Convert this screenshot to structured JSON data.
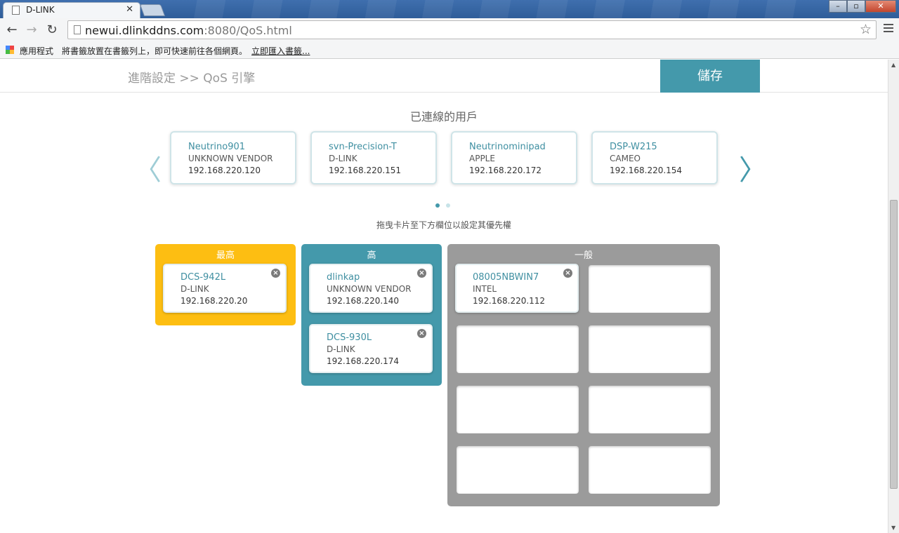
{
  "browser": {
    "tab_title": "D-LINK",
    "tab_close": "✕",
    "back": "←",
    "forward": "→",
    "reload": "↻",
    "url_host": "newui.dlinkddns.com",
    "url_rest": ":8080/QoS.html",
    "bookmarks": {
      "apps": "應用程式",
      "tip": "將書籤放置在書籤列上，即可快速前往各個網頁。",
      "import": "立即匯入書籤..."
    }
  },
  "header": {
    "breadcrumb": "進階設定 >> QoS 引擎",
    "save_label": "儲存"
  },
  "connected": {
    "title": "已連線的用戶",
    "prev": "〈",
    "next": "〉",
    "clients": [
      {
        "name": "Neutrino901",
        "vendor": "UNKNOWN VENDOR",
        "ip": "192.168.220.120"
      },
      {
        "name": "svn-Precision-T",
        "vendor": "D-LINK",
        "ip": "192.168.220.151"
      },
      {
        "name": "Neutrinominipad",
        "vendor": "APPLE",
        "ip": "192.168.220.172"
      },
      {
        "name": "DSP-W215",
        "vendor": "CAMEO",
        "ip": "192.168.220.154"
      }
    ],
    "page_count": 2,
    "current_page": 1
  },
  "instruction": "拖曳卡片至下方欄位以設定其優先權",
  "priorities": {
    "highest": {
      "title": "最高",
      "color": "#fdbe12",
      "devices": [
        {
          "name": "DCS-942L",
          "vendor": "D-LINK",
          "ip": "192.168.220.20"
        }
      ]
    },
    "high": {
      "title": "高",
      "color": "#4499ab",
      "devices": [
        {
          "name": "dlinkap",
          "vendor": "UNKNOWN VENDOR",
          "ip": "192.168.220.140"
        },
        {
          "name": "DCS-930L",
          "vendor": "D-LINK",
          "ip": "192.168.220.174"
        }
      ]
    },
    "normal": {
      "title": "一般",
      "color": "#9b9b9b",
      "devices": [
        {
          "name": "08005NBWIN7",
          "vendor": "INTEL",
          "ip": "192.168.220.112"
        }
      ]
    }
  },
  "remove_icon": "×",
  "colors": {
    "accent": "#4499ab",
    "highest": "#fdbe12",
    "normal": "#9b9b9b"
  }
}
